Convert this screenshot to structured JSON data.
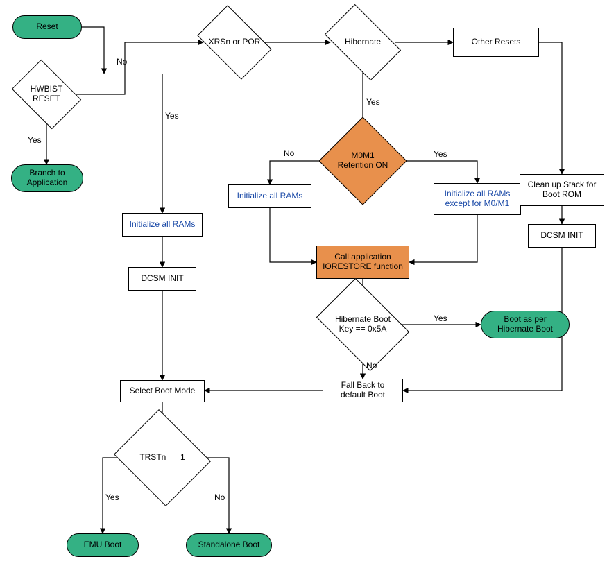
{
  "nodes": {
    "reset": "Reset",
    "hwbist": "HWBIST RESET",
    "branch_app": "Branch to Application",
    "xrsn_por": "XRSn or POR",
    "hibernate": "Hibernate",
    "other_resets": "Other Resets",
    "m0m1": "M0M1 Retention ON",
    "init_rams_left": "Initialize all RAMs",
    "init_rams_mid": "Initialize all RAMs",
    "init_rams_right": "Initialize all RAMs except for M0/M1",
    "cleanup_stack": "Clean up Stack for Boot ROM",
    "dcsm_right": "DCSM INIT",
    "iorestore": "Call application IORESTORE function",
    "dcsm_left": "DCSM INIT",
    "hib_key": "Hibernate Boot Key == 0x5A",
    "boot_hib": "Boot as per Hibernate Boot",
    "fallback": "Fall Back to default Boot",
    "select_boot": "Select Boot Mode",
    "trstn": "TRSTn == 1",
    "emu_boot": "EMU Boot",
    "standalone": "Standalone Boot"
  },
  "edges": {
    "yes": "Yes",
    "no": "No"
  }
}
